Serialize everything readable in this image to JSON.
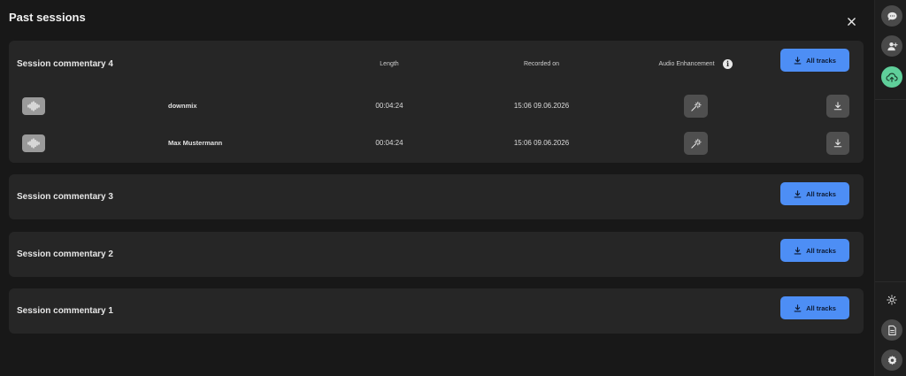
{
  "page": {
    "title": "Past sessions"
  },
  "columns": {
    "length": "Length",
    "recorded_on": "Recorded on",
    "audio_enhancement": "Audio Enhancement"
  },
  "sessions": [
    {
      "title": "Session commentary 4",
      "all_tracks_label": "All tracks",
      "tracks": [
        {
          "name": "downmix",
          "length": "00:04:24",
          "recorded_on": "15:06 09.06.2026"
        },
        {
          "name": "Max Mustermann",
          "length": "00:04:24",
          "recorded_on": "15:06 09.06.2026"
        }
      ]
    },
    {
      "title": "Session commentary 3",
      "all_tracks_label": "All tracks"
    },
    {
      "title": "Session commentary 2",
      "all_tracks_label": "All tracks"
    },
    {
      "title": "Session commentary 1",
      "all_tracks_label": "All tracks"
    }
  ],
  "icons": {
    "close": "close-icon",
    "download": "download-icon",
    "waveform": "waveform-icon",
    "magic_wand": "magic-wand-icon",
    "info": "info-icon",
    "sidebar": [
      "chat-icon",
      "add-user-icon",
      "cloud-upload-icon",
      "sun-icon",
      "document-icon",
      "settings-icon"
    ]
  },
  "colors": {
    "accent": "#4d8ef5",
    "active_sidebar": "#5fcf9a",
    "card_bg": "#262626",
    "page_bg": "#181818"
  }
}
